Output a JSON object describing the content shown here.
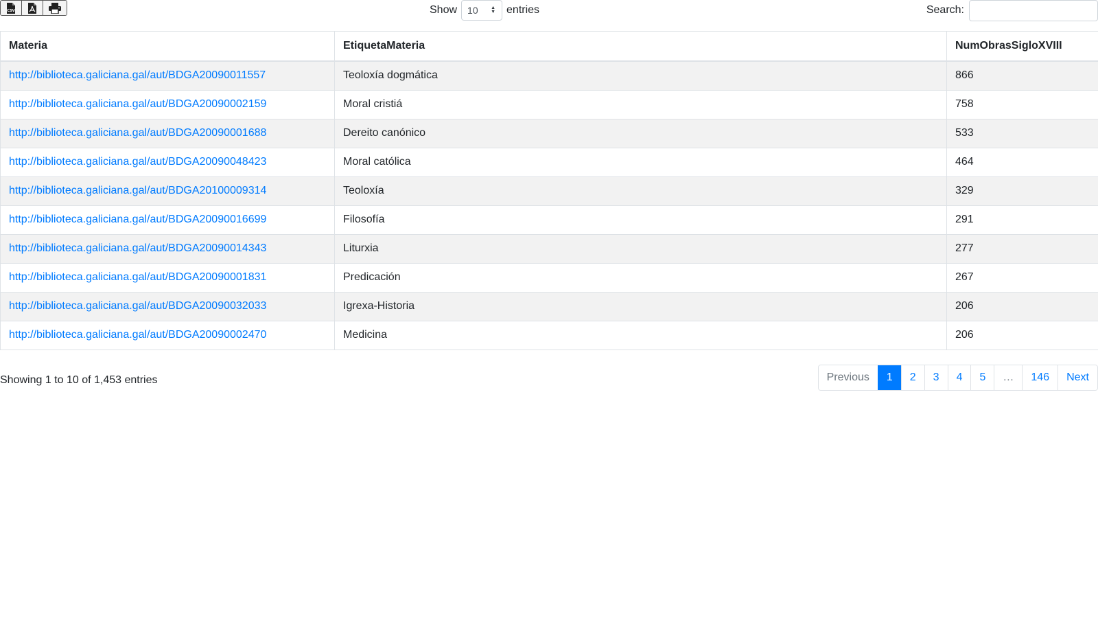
{
  "toolbar": {
    "export_buttons": [
      {
        "icon": "csv-file-icon"
      },
      {
        "icon": "pdf-file-icon"
      },
      {
        "icon": "printer-icon"
      }
    ]
  },
  "length": {
    "show_label": "Show",
    "value": "10",
    "entries_label": "entries"
  },
  "search": {
    "label": "Search:",
    "value": "",
    "placeholder": ""
  },
  "table": {
    "headers": [
      "Materia",
      "EtiquetaMateria",
      "NumObrasSigloXVIII"
    ],
    "rows": [
      {
        "materia": "http://biblioteca.galiciana.gal/aut/BDGA20090011557",
        "etiqueta": "Teoloxía dogmática",
        "num": "866"
      },
      {
        "materia": "http://biblioteca.galiciana.gal/aut/BDGA20090002159",
        "etiqueta": "Moral cristiá",
        "num": "758"
      },
      {
        "materia": "http://biblioteca.galiciana.gal/aut/BDGA20090001688",
        "etiqueta": "Dereito canónico",
        "num": "533"
      },
      {
        "materia": "http://biblioteca.galiciana.gal/aut/BDGA20090048423",
        "etiqueta": "Moral católica",
        "num": "464"
      },
      {
        "materia": "http://biblioteca.galiciana.gal/aut/BDGA20100009314",
        "etiqueta": "Teoloxía",
        "num": "329"
      },
      {
        "materia": "http://biblioteca.galiciana.gal/aut/BDGA20090016699",
        "etiqueta": "Filosofía",
        "num": "291"
      },
      {
        "materia": "http://biblioteca.galiciana.gal/aut/BDGA20090014343",
        "etiqueta": "Liturxia",
        "num": "277"
      },
      {
        "materia": "http://biblioteca.galiciana.gal/aut/BDGA20090001831",
        "etiqueta": "Predicación",
        "num": "267"
      },
      {
        "materia": "http://biblioteca.galiciana.gal/aut/BDGA20090032033",
        "etiqueta": "Igrexa-Historia",
        "num": "206"
      },
      {
        "materia": "http://biblioteca.galiciana.gal/aut/BDGA20090002470",
        "etiqueta": "Medicina",
        "num": "206"
      }
    ]
  },
  "info": "Showing 1 to 10 of 1,453 entries",
  "pagination": {
    "previous": "Previous",
    "pages": [
      "1",
      "2",
      "3",
      "4",
      "5",
      "…",
      "146"
    ],
    "active": "1",
    "next": "Next"
  },
  "colors": {
    "link": "#007bff",
    "active_page_bg": "#007bff",
    "stripe": "#f2f2f2",
    "border": "#dee2e6"
  }
}
